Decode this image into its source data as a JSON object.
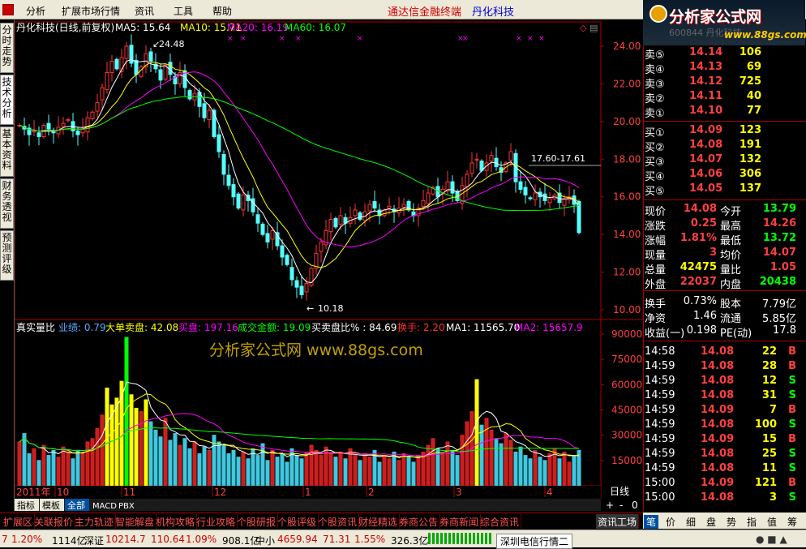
{
  "menu": {
    "items": [
      "分析",
      "扩展市场行情",
      "资讯",
      "工具",
      "帮助"
    ],
    "title1": "通达信金融终端",
    "title2": "丹化科技"
  },
  "logo": {
    "title": "分析家公式网",
    "url": "www.88gs.com",
    "hidden_text": "600844 丹化科技"
  },
  "left_tabs": [
    "分时走势",
    "技术分析",
    "基本资料",
    "财务透视",
    "预测评级"
  ],
  "main_header": {
    "name": "丹化科技(日线,前复权)",
    "ma5": "MA5: 15.64",
    "ma10": "MA10: 15.71",
    "ma20": "MA20: 16.19",
    "ma60": "MA60: 16.07"
  },
  "price_axis": [
    "24.00",
    "22.00",
    "20.00",
    "18.00",
    "16.00",
    "14.00",
    "12.00",
    "10.00"
  ],
  "annotations": {
    "high": "24.48",
    "low": "10.18",
    "range": "17.60-17.61"
  },
  "vol_header": {
    "title": "真实量比",
    "a": "业绩: 0.79",
    "b": "大单卖盘: 42.08",
    "c": "买盘: 197.16",
    "d": "成交金额: 19.09",
    "e": "买卖盘比% : 84.69",
    "f": "换手: 2.20",
    "g": "MA1: 11565.70",
    "h": "MA2: 15657.9"
  },
  "vol_axis": [
    "90000",
    "75000",
    "60000",
    "45000",
    "30000",
    "15000"
  ],
  "watermark": "分析家公式网  www.88gs.com",
  "date_axis": [
    "2011年",
    "10",
    "11",
    "12",
    "1",
    "2",
    "3",
    "4"
  ],
  "period": "日线",
  "sub_tabs": [
    "指标",
    "模板",
    "全部",
    "MACD",
    "PBX"
  ],
  "nav_buttons": [
    "+",
    "-",
    "0"
  ],
  "orderbook": {
    "sells": [
      {
        "l": "卖⑤",
        "p": "14.14",
        "v": "106"
      },
      {
        "l": "卖④",
        "p": "14.13",
        "v": "69"
      },
      {
        "l": "卖③",
        "p": "14.12",
        "v": "725"
      },
      {
        "l": "卖②",
        "p": "14.11",
        "v": "40"
      },
      {
        "l": "卖①",
        "p": "14.10",
        "v": "77"
      }
    ],
    "buys": [
      {
        "l": "买①",
        "p": "14.09",
        "v": "123"
      },
      {
        "l": "买②",
        "p": "14.08",
        "v": "191"
      },
      {
        "l": "买③",
        "p": "14.07",
        "v": "132"
      },
      {
        "l": "买④",
        "p": "14.06",
        "v": "306"
      },
      {
        "l": "买⑤",
        "p": "14.05",
        "v": "137"
      }
    ]
  },
  "quote": [
    {
      "a": "现价",
      "b": "14.08",
      "c": "今开",
      "d": "13.79"
    },
    {
      "a": "涨跌",
      "b": "0.25",
      "c": "最高",
      "d": "14.26"
    },
    {
      "a": "涨幅",
      "b": "1.81%",
      "c": "最低",
      "d": "13.72"
    },
    {
      "a": "现量",
      "b": "3",
      "c": "均价",
      "d": "14.07"
    },
    {
      "a": "总量",
      "b": "42475",
      "c": "量比",
      "d": "1.05"
    },
    {
      "a": "外盘",
      "b": "22037",
      "c": "内盘",
      "d": "20438"
    }
  ],
  "fund": [
    {
      "a": "换手",
      "b": "0.73%",
      "c": "股本",
      "d": "7.79亿"
    },
    {
      "a": "净资",
      "b": "1.46",
      "c": "流通",
      "d": "5.85亿"
    },
    {
      "a": "收益(一)",
      "b": "0.198",
      "c": "PE(动)",
      "d": "17.8"
    }
  ],
  "ticks": [
    {
      "t": "14:58",
      "p": "14.08",
      "v": "22",
      "s": "B"
    },
    {
      "t": "14:59",
      "p": "14.08",
      "v": "28",
      "s": "B"
    },
    {
      "t": "14:59",
      "p": "14.08",
      "v": "12",
      "s": "S"
    },
    {
      "t": "14:59",
      "p": "14.08",
      "v": "31",
      "s": "S"
    },
    {
      "t": "14:59",
      "p": "14.09",
      "v": "7",
      "s": "B"
    },
    {
      "t": "14:59",
      "p": "14.08",
      "v": "100",
      "s": "S"
    },
    {
      "t": "14:59",
      "p": "14.09",
      "v": "15",
      "s": "B"
    },
    {
      "t": "14:59",
      "p": "14.08",
      "v": "25",
      "s": "S"
    },
    {
      "t": "14:59",
      "p": "14.08",
      "v": "11",
      "s": "S"
    },
    {
      "t": "15:00",
      "p": "14.09",
      "v": "121",
      "s": "B"
    },
    {
      "t": "15:00",
      "p": "14.08",
      "v": "3",
      "s": "S"
    }
  ],
  "right_tabs": [
    "笔",
    "价",
    "细",
    "盘",
    "势",
    "指",
    "值",
    "筹"
  ],
  "bottom_tabs": [
    "扩展区",
    "关联报价",
    "主力轨迹",
    "智能解盘",
    "机构攻略",
    "行业攻略",
    "个股研报",
    "个股评级",
    "个股资讯",
    "财经精选",
    "券商公告",
    "券商新闻",
    "综合资讯",
    "资讯工场"
  ],
  "status": {
    "a": "7",
    "b": "1.20%",
    "c": "1114亿",
    "d": "深证",
    "e": "10214.7",
    "f": "110.64",
    "g": "1.09%",
    "h": "908.1亿",
    "i": "中小",
    "j": "4659.94",
    "k": "71.31",
    "l": "1.55%",
    "m": "326.3亿",
    "n": "深圳电信行情二"
  },
  "chart_data": {
    "type": "candlestick",
    "price_range": [
      10,
      25
    ],
    "volume_range": [
      0,
      90000
    ],
    "closes": [
      19.8,
      19.6,
      19.3,
      19.5,
      19.2,
      19.8,
      19.6,
      19.4,
      19.7,
      19.9,
      20.1,
      19.5,
      19.3,
      19.6,
      20.2,
      20.5,
      21.0,
      21.8,
      22.6,
      23.2,
      22.8,
      23.4,
      24.0,
      23.1,
      22.5,
      22.9,
      23.6,
      23.2,
      22.8,
      22.2,
      23.0,
      22.5,
      22.0,
      22.6,
      21.8,
      21.2,
      21.5,
      20.8,
      20.2,
      20.6,
      19.2,
      18.4,
      17.2,
      16.6,
      16.0,
      15.4,
      16.1,
      15.8,
      15.2,
      14.6,
      14.0,
      13.6,
      14.2,
      13.4,
      12.8,
      12.4,
      11.6,
      11.2,
      10.8,
      11.4,
      12.2,
      13.0,
      13.6,
      14.2,
      14.8,
      14.4,
      15.0,
      14.6,
      14.9,
      15.3,
      14.8,
      15.2,
      15.6,
      15.4,
      15.0,
      15.3,
      15.5,
      15.2,
      15.4,
      15.6,
      15.3,
      15.0,
      15.4,
      15.8,
      16.2,
      16.5,
      16.0,
      16.4,
      16.8,
      16.2,
      15.8,
      16.6,
      17.2,
      17.8,
      18.0,
      17.4,
      17.8,
      18.2,
      17.6,
      17.3,
      17.8,
      18.4,
      16.8,
      16.4,
      16.1,
      15.9,
      16.2,
      16.0,
      15.8,
      15.9,
      16.1,
      15.7,
      15.9,
      16.0,
      15.6,
      14.1
    ],
    "volumes": [
      26000,
      31000,
      19000,
      22000,
      15000,
      24000,
      18000,
      21000,
      17000,
      23000,
      20000,
      16000,
      21000,
      19000,
      26000,
      28000,
      34000,
      42000,
      58000,
      48000,
      52000,
      62000,
      88000,
      54000,
      46000,
      44000,
      51000,
      38000,
      33000,
      29000,
      40000,
      27000,
      31000,
      24000,
      28000,
      22000,
      26000,
      19000,
      23000,
      21000,
      30000,
      26000,
      24000,
      19000,
      21000,
      17000,
      20000,
      16000,
      22000,
      18000,
      25000,
      15000,
      21000,
      17000,
      19000,
      14000,
      22000,
      18000,
      16000,
      20000,
      24000,
      21000,
      18000,
      23000,
      19000,
      17000,
      20000,
      16000,
      22000,
      18000,
      15000,
      19000,
      17000,
      21000,
      14000,
      18000,
      16000,
      20000,
      15000,
      19000,
      17000,
      14000,
      18000,
      20000,
      24000,
      28000,
      22000,
      19000,
      26000,
      21000,
      18000,
      30000,
      38000,
      44000,
      63000,
      36000,
      40000,
      33000,
      28000,
      25000,
      31000,
      27000,
      20000,
      23000,
      18000,
      16000,
      21000,
      17000,
      15000,
      19000,
      22000,
      16000,
      20000,
      14000,
      18000,
      21000
    ]
  }
}
